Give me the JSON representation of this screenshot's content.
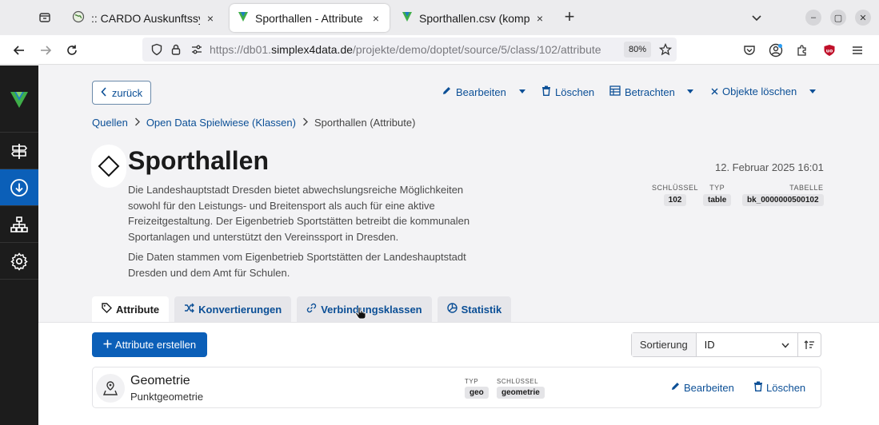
{
  "browser": {
    "tabs": [
      {
        "title": ":: CARDO Auskunftssystem",
        "close": "×"
      },
      {
        "title": "Sporthallen - Attribute",
        "close": "×"
      },
      {
        "title": "Sporthallen.csv (komplett)",
        "close": "×"
      }
    ],
    "new_tab": "+",
    "url_prefix": "https://db01.",
    "url_host": "simplex4data.de",
    "url_path": "/projekte/demo/doptet/source/5/class/102/attribute",
    "zoom": "80%",
    "window_buttons": {
      "minimize": "–",
      "maximize": "▢",
      "close": "✕"
    }
  },
  "colors": {
    "accent": "#0b5fb8",
    "link": "#0b4f96",
    "sidebar": "#1c1c1c",
    "logo_green": "#3fae49"
  },
  "toolbar": {
    "back_label": "zurück",
    "edit_label": "Bearbeiten",
    "delete_label": "Löschen",
    "view_label": "Betrachten",
    "delete_objects_label": "Objekte löschen"
  },
  "breadcrumb": [
    {
      "label": "Quellen"
    },
    {
      "label": "Open Data Spielwiese (Klassen)"
    },
    {
      "label": "Sporthallen (Attribute)"
    }
  ],
  "page": {
    "title": "Sporthallen",
    "description_1": "Die Landeshauptstadt Dresden bietet abwechslungsreiche Möglichkeiten sowohl für den Leistungs- und Breitensport als auch für eine aktive Freizeitgestaltung. Der Eigenbetrieb Sportstätten betreibt die kommunalen Sportanlagen und unterstützt den Vereinssport in Dresden.",
    "description_2": "Die Daten stammen vom Eigenbetrieb Sportstätten der Landeshauptstadt Dresden und dem Amt für Schulen.",
    "datetime": "12. Februar 2025 16:01",
    "meta": {
      "key_label": "Schlüssel",
      "key_value": "102",
      "type_label": "Typ",
      "type_value": "table",
      "table_label": "Tabelle",
      "table_value": "bk_0000000500102"
    }
  },
  "tabs": [
    {
      "label": "Attribute"
    },
    {
      "label": "Konvertierungen"
    },
    {
      "label": "Verbindungsklassen"
    },
    {
      "label": "Statistik"
    }
  ],
  "list": {
    "create_label": "Attribute erstellen",
    "sort_label": "Sortierung",
    "sort_value": "ID"
  },
  "attributes": [
    {
      "name": "Geometrie",
      "subtitle": "Punktgeometrie",
      "type_label": "Typ",
      "type_value": "geo",
      "key_label": "Schlüssel",
      "key_value": "geometrie",
      "edit_label": "Bearbeiten",
      "delete_label": "Löschen"
    }
  ]
}
